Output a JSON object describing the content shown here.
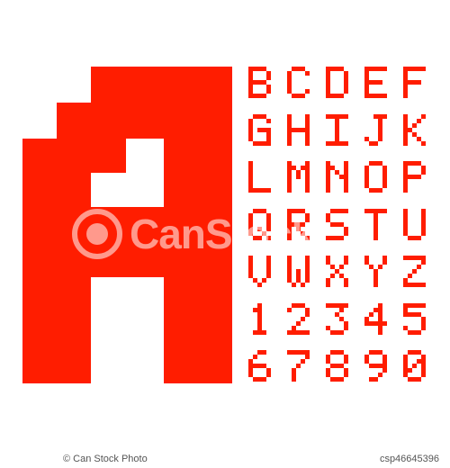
{
  "colors": {
    "glyph": "#ff1d00",
    "background": "#ffffff",
    "caption": "#555555"
  },
  "big_letter": "A",
  "alphabet_rows": [
    [
      "B",
      "C",
      "D",
      "E",
      "F"
    ],
    [
      "G",
      "H",
      "I",
      "J",
      "K"
    ],
    [
      "L",
      "M",
      "N",
      "O",
      "P"
    ],
    [
      "Q",
      "R",
      "S",
      "T",
      "U"
    ],
    [
      "V",
      "W",
      "X",
      "Y",
      "Z"
    ],
    [
      "1",
      "2",
      "3",
      "4",
      "5"
    ],
    [
      "6",
      "7",
      "8",
      "9",
      "0"
    ]
  ],
  "watermark": {
    "text": "CanStock"
  },
  "footer": {
    "left": "© Can Stock Photo",
    "right": "csp46645396"
  }
}
